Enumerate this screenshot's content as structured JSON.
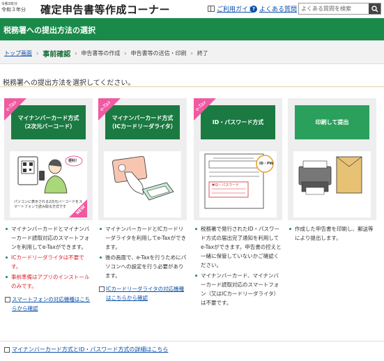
{
  "header": {
    "era_line1": "令和3年分",
    "era_line2": "令和３年分",
    "title": "確定申告書等作成コーナー",
    "guide_label": "ご利用ガイド",
    "faq_label": "よくある質問",
    "search_placeholder": "よくある質問を検索"
  },
  "banner": {
    "title": "税務署への提出方法の選択"
  },
  "breadcrumb": {
    "items": [
      "トップ画面",
      "事前確認",
      "申告書等の作成",
      "申告書等の送信・印刷",
      "終了"
    ]
  },
  "instruction": "税務署への提出方法を選択してください。",
  "cards": [
    {
      "badge": "e-Tax",
      "line1": "マイナンバーカード方式",
      "line2": "（2次元バーコード）",
      "caption": "パソコンに表示される2次元バーコードをスマートフォンで読み取る方式です",
      "new_badge": "NEW",
      "bubble": "便利！"
    },
    {
      "badge": "e-Tax",
      "line1": "マイナンバーカード方式",
      "line2": "（ICカードリーダライタ）"
    },
    {
      "badge": "e-Tax",
      "line1": "ID・パスワード方式",
      "line2": "",
      "idpw_badge": "ID・PW",
      "form_title": "▼ID・パスワード"
    },
    {
      "badge": "",
      "line1": "印刷して提出",
      "line2": ""
    }
  ],
  "descriptions": [
    {
      "items": [
        {
          "text": "マイナンバーカードとマイナンバーカード読取対応のスマートフォンを利用してe-Taxができます。",
          "red": false
        },
        {
          "text": "ICカードリーダライタは不要です。",
          "red": true
        },
        {
          "text": "事前準備はアプリのインストールのみです。",
          "red": true
        }
      ],
      "link": "スマートフォンの対応機種はこちらから確認"
    },
    {
      "items": [
        {
          "text": "マイナンバーカードとICカードリーダライタを利用してe-Taxができます。",
          "red": false
        },
        {
          "text": "後の画面で、e-Taxを行うためにパソコンへの設定を行う必要があります。",
          "red": false
        }
      ],
      "link": "ICカードリーダライタの対応機種はこちらから確認"
    },
    {
      "items": [
        {
          "text": "税務署で発行されたID・パスワード方式の届出完了通知を利用してe-Taxができます。申告書の控えと一緒に保管していないかご確認ください。",
          "red": false
        },
        {
          "text": "マイナンバーカード、マイナンバーカード読取対応のスマートフォン（又はICカードリーダライタ）は不要です。",
          "red": false
        }
      ],
      "link": ""
    },
    {
      "items": [
        {
          "text": "作成した申告書を印刷し、郵送等により提出します。",
          "red": false
        }
      ],
      "link": ""
    }
  ],
  "bottom_link": "マイナンバーカード方式とID・パスワード方式の詳細はこちら",
  "colors": {
    "banner_green": "#1a8a4a",
    "card_green": "#1a7a42",
    "etax_pink": "#f05aa0",
    "link_blue": "#0b4fa8",
    "warn_red": "#d8262d"
  }
}
